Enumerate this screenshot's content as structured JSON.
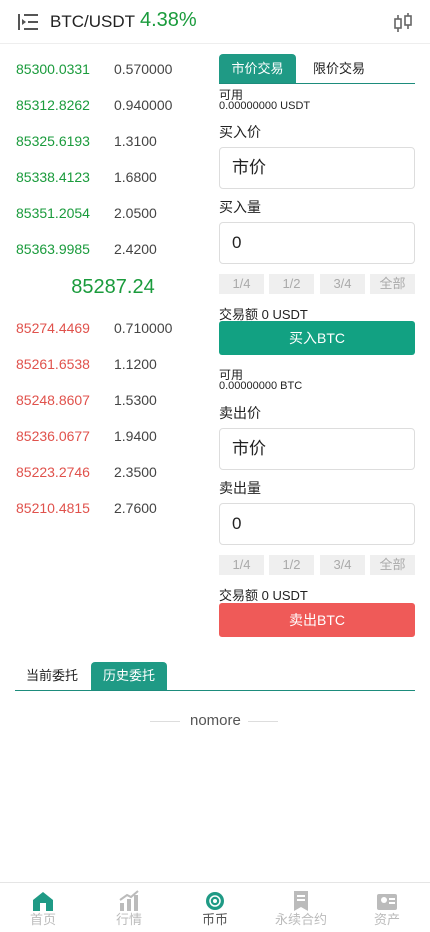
{
  "header": {
    "pair": "BTC/USDT",
    "change_pct": "4.38%"
  },
  "order_book": {
    "buy_rows": [
      {
        "price": "85300.0331",
        "qty": "0.570000"
      },
      {
        "price": "85312.8262",
        "qty": "0.940000"
      },
      {
        "price": "85325.6193",
        "qty": "1.3100"
      },
      {
        "price": "85338.4123",
        "qty": "1.6800"
      },
      {
        "price": "85351.2054",
        "qty": "2.0500"
      },
      {
        "price": "85363.9985",
        "qty": "2.4200"
      }
    ],
    "last_price": "85287.24",
    "sell_rows": [
      {
        "price": "85274.4469",
        "qty": "0.710000"
      },
      {
        "price": "85261.6538",
        "qty": "1.1200"
      },
      {
        "price": "85248.8607",
        "qty": "1.5300"
      },
      {
        "price": "85236.0677",
        "qty": "1.9400"
      },
      {
        "price": "85223.2746",
        "qty": "2.3500"
      },
      {
        "price": "85210.4815",
        "qty": "2.7600"
      }
    ]
  },
  "trade": {
    "tabs": [
      "市价交易",
      "限价交易"
    ],
    "buy": {
      "available_label": "可用",
      "available_value": "0.00000000 USDT",
      "price_label": "买入价",
      "price_value": "市价",
      "amount_label": "买入量",
      "amount_value": "0",
      "pct_buttons": [
        "1/4",
        "1/2",
        "3/4",
        "全部"
      ],
      "turnover": "交易额 0 USDT",
      "button": "买入BTC"
    },
    "sell": {
      "available_label": "可用",
      "available_value": "0.00000000 BTC",
      "price_label": "卖出价",
      "price_value": "市价",
      "amount_label": "卖出量",
      "amount_value": "0",
      "pct_buttons": [
        "1/4",
        "1/2",
        "3/4",
        "全部"
      ],
      "turnover": "交易额 0 USDT",
      "button": "卖出BTC"
    }
  },
  "orders": {
    "tabs": [
      "当前委托",
      "历史委托"
    ],
    "empty_text": "nomore"
  },
  "bottom_nav": [
    {
      "label": "首页",
      "icon": "home-icon"
    },
    {
      "label": "行情",
      "icon": "chart-icon"
    },
    {
      "label": "币币",
      "icon": "coin-icon"
    },
    {
      "label": "永续合约",
      "icon": "contract-icon"
    },
    {
      "label": "资产",
      "icon": "wallet-icon"
    }
  ],
  "colors": {
    "accent": "#1f9a85",
    "up": "#1a9b3c",
    "down": "#e0524c",
    "buy_button": "#12a182",
    "sell_button": "#ef5a58"
  }
}
